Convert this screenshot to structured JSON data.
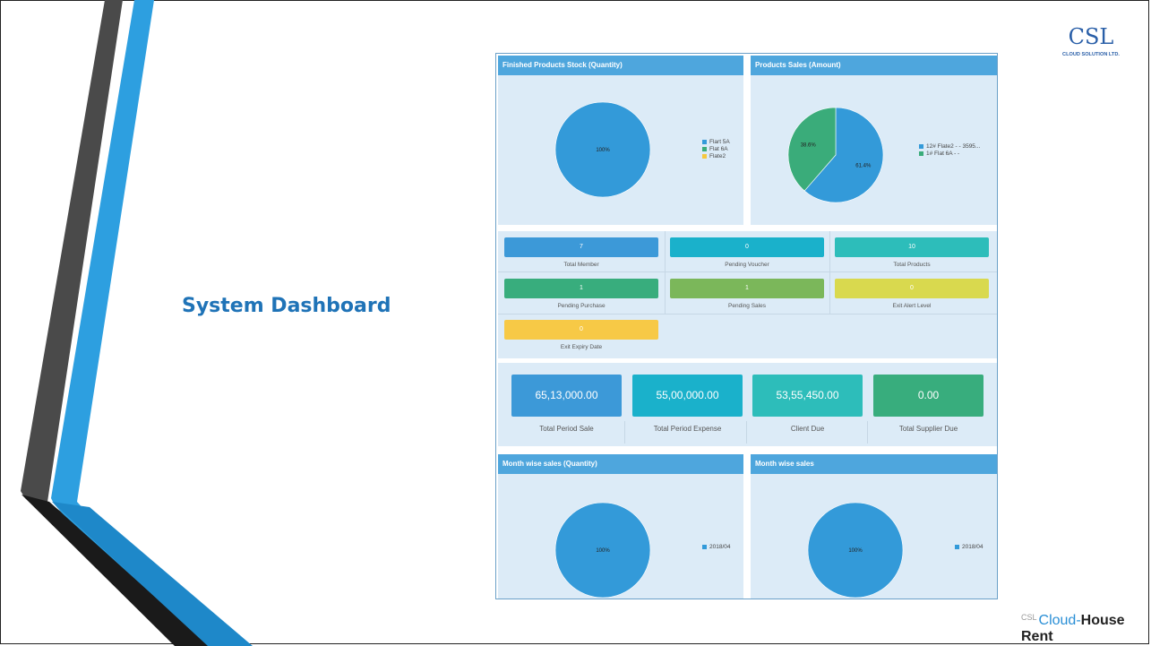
{
  "slide": {
    "title": "System Dashboard",
    "footer_brand": {
      "mark": "CSL",
      "cloud": "Cloud-",
      "house": "House Rent"
    },
    "logo": {
      "letters": "CSL",
      "caption": "CLOUD SOLUTION LTD."
    }
  },
  "dashboard": {
    "panels": {
      "stock": {
        "title": "Finished Products Stock (Quantity)",
        "pie_label": "100%",
        "legend": [
          "Flart 5A",
          "Flat 6A",
          "Flate2"
        ],
        "colors": [
          "#339ad9",
          "#3aac7a",
          "#f6c83e"
        ]
      },
      "sales": {
        "title": "Products Sales (Amount)",
        "pie_labels": [
          "38.6%",
          "61.4%"
        ],
        "legend": [
          "12# Flate2 - - 3595...",
          "1# Flat 6A - -"
        ],
        "colors": [
          "#339ad9",
          "#3aac7a"
        ]
      },
      "month_qty": {
        "title": "Month wise sales (Quantity)",
        "pie_label": "100%",
        "legend": [
          "2018/04"
        ]
      },
      "month_sales": {
        "title": "Month wise sales",
        "pie_label": "100%",
        "legend": [
          "2018/04"
        ]
      }
    },
    "stats": [
      {
        "value": "7",
        "label": "Total Member",
        "color": "#3c99d8"
      },
      {
        "value": "0",
        "label": "Pending Voucher",
        "color": "#1ab1cb"
      },
      {
        "value": "10",
        "label": "Total Products",
        "color": "#2dbdba"
      },
      {
        "value": "1",
        "label": "Pending Purchase",
        "color": "#38ad7d"
      },
      {
        "value": "1",
        "label": "Pending Sales",
        "color": "#7bb75a"
      },
      {
        "value": "0",
        "label": "Exit Alert Level",
        "color": "#d9d94e"
      },
      {
        "value": "0",
        "label": "Exit Expiry Date",
        "color": "#f7c946"
      }
    ],
    "totals": [
      {
        "value": "65,13,000.00",
        "label": "Total Period Sale",
        "color": "#3c99d8"
      },
      {
        "value": "55,00,000.00",
        "label": "Total Period Expense",
        "color": "#1ab1cb"
      },
      {
        "value": "53,55,450.00",
        "label": "Client Due",
        "color": "#2dbdba"
      },
      {
        "value": "0.00",
        "label": "Total Supplier Due",
        "color": "#38ad7d"
      }
    ]
  },
  "chart_data": [
    {
      "type": "pie",
      "title": "Finished Products Stock (Quantity)",
      "categories": [
        "Flart 5A",
        "Flat 6A",
        "Flate2"
      ],
      "values": [
        100,
        0,
        0
      ]
    },
    {
      "type": "pie",
      "title": "Products Sales (Amount)",
      "categories": [
        "12# Flate2 - - 3595...",
        "1# Flat 6A - -"
      ],
      "values": [
        61.4,
        38.6
      ]
    },
    {
      "type": "pie",
      "title": "Month wise sales (Quantity)",
      "categories": [
        "2018/04"
      ],
      "values": [
        100
      ]
    },
    {
      "type": "pie",
      "title": "Month wise sales",
      "categories": [
        "2018/04"
      ],
      "values": [
        100
      ]
    }
  ]
}
